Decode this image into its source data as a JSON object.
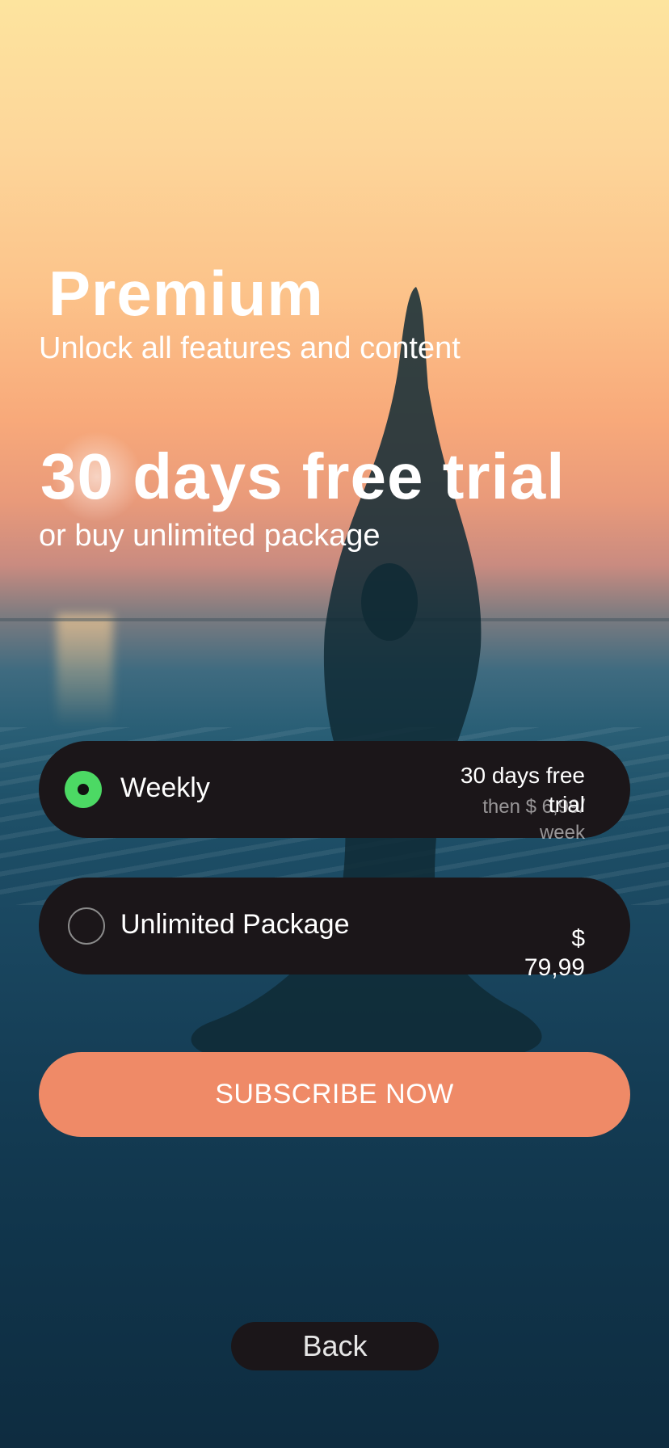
{
  "header": {
    "title": "Premium",
    "subtitle": "Unlock all features and content"
  },
  "trial": {
    "headline": "30 days free trial",
    "subline": "or buy unlimited package"
  },
  "plans": [
    {
      "label": "Weekly",
      "selected": true,
      "price_main": "30 days free trial",
      "price_sub": "then $ 6,99/ week"
    },
    {
      "label": "Unlimited Package",
      "selected": false,
      "price_main": "$ 79,99"
    }
  ],
  "actions": {
    "subscribe_label": "SUBSCRIBE NOW",
    "back_label": "Back"
  },
  "colors": {
    "accent": "#ef8a67",
    "selected_radio": "#4cd964",
    "card_bg": "#1b1619"
  },
  "icons": {
    "selected_radio": "radio-selected-icon",
    "unselected_radio": "radio-unselected-icon"
  }
}
